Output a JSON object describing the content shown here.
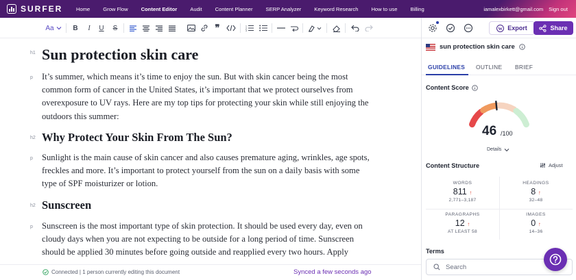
{
  "app": {
    "logo_text": "SURFER"
  },
  "nav": {
    "items": [
      {
        "label": "Home"
      },
      {
        "label": "Grow Flow"
      },
      {
        "label": "Content Editor"
      },
      {
        "label": "Audit"
      },
      {
        "label": "Content Planner"
      },
      {
        "label": "SERP Analyzer"
      },
      {
        "label": "Keyword Research"
      },
      {
        "label": "How to use"
      },
      {
        "label": "Billing"
      }
    ],
    "active": "Content Editor",
    "user_email": "iamalexbirkett@gmail.com",
    "sign_out": "Sign out"
  },
  "toolbar": {
    "text_style": "Aa",
    "tools": [
      "bold",
      "italic",
      "underline",
      "strikethrough",
      "align-left",
      "align-center",
      "align-right",
      "align-justify",
      "image",
      "link",
      "quote",
      "code",
      "numbered-list",
      "bulleted-list",
      "horizontal-rule",
      "hard-break",
      "highlight",
      "clear-format",
      "undo",
      "redo"
    ]
  },
  "editor": {
    "blocks": [
      {
        "type": "h1",
        "marker": "h1",
        "text": "Sun protection skin care"
      },
      {
        "type": "p",
        "marker": "p",
        "lines": [
          "It’s summer, which means it’s time to enjoy the sun. But with skin cancer being the most",
          "common form of cancer in the United States, it’s important that we protect ourselves from",
          "overexposure to UV rays. Here are my top tips for protecting your skin while still enjoying the",
          "outdoors this summer:"
        ]
      },
      {
        "type": "h2",
        "marker": "h2",
        "text": "Why Protect Your Skin From The Sun?"
      },
      {
        "type": "p",
        "marker": "p",
        "lines": [
          "Sunlight is the main cause of skin cancer and also causes premature aging, wrinkles, age spots,",
          "freckles and more. It’s important to protect yourself from the sun on a daily basis with some",
          "type of SPF moisturizer or lotion."
        ]
      },
      {
        "type": "h2",
        "marker": "h2",
        "text": "Sunscreen"
      },
      {
        "type": "p",
        "marker": "p",
        "lines": [
          "Sunscreen is the most important type of skin protection. It should be used every day, even on",
          "cloudy days when you are not expecting to be outside for a long period of time. Sunscreen",
          "should be applied 30 minutes before going outside and reapplied every two hours. Apply"
        ]
      }
    ]
  },
  "status": {
    "connected": "Connected | 1 person currently editing this document",
    "synced": "Synced a few seconds ago"
  },
  "panel": {
    "export_label": "Export",
    "share_label": "Share",
    "keyword": "sun protection skin care",
    "tabs": [
      {
        "label": "GUIDELINES"
      },
      {
        "label": "OUTLINE"
      },
      {
        "label": "BRIEF"
      }
    ],
    "active_tab": "GUIDELINES",
    "content_score": {
      "title": "Content Score",
      "value": "46",
      "max": "/100",
      "score_fraction": 0.46,
      "details_label": "Details"
    },
    "structure": {
      "title": "Content Structure",
      "adjust_label": "Adjust",
      "stats": [
        {
          "label": "WORDS",
          "value": "811",
          "range": "2,771–3,187"
        },
        {
          "label": "HEADINGS",
          "value": "8",
          "range": "32–48"
        },
        {
          "label": "PARAGRAPHS",
          "value": "12",
          "range": "AT LEAST 58"
        },
        {
          "label": "IMAGES",
          "value": "0",
          "range": "14–36"
        }
      ]
    },
    "terms": {
      "title": "Terms",
      "search_placeholder": "Search"
    }
  },
  "colors": {
    "nav_bg": "#4a1b6d",
    "accent": "#6b2fb3",
    "tab_active": "#2a3fa8",
    "gauge_red": "#e6484a",
    "gauge_orange": "#f09a5e",
    "gauge_peach": "#f6d4c0",
    "gauge_green": "#cdeed3",
    "arrow_up_red": "#e04b3a"
  }
}
